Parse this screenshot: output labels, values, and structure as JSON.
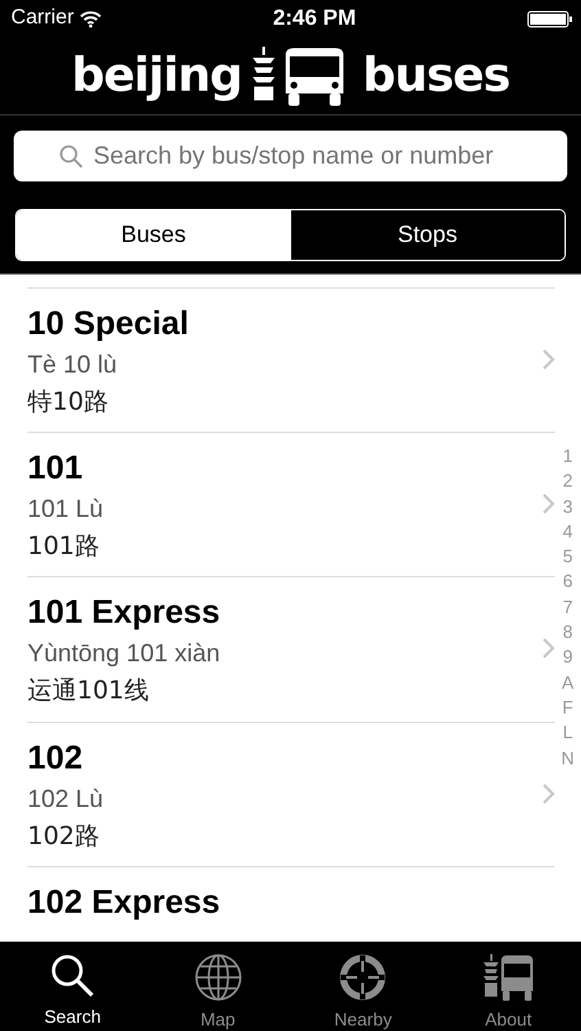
{
  "status_bar": {
    "carrier": "Carrier",
    "time": "2:46 PM"
  },
  "logo": {
    "left": "beijing",
    "right": "buses"
  },
  "search": {
    "placeholder": "Search by bus/stop name or number"
  },
  "segments": [
    {
      "label": "Buses",
      "selected": true
    },
    {
      "label": "Stops",
      "selected": false
    }
  ],
  "routes": [
    {
      "name": "10 Special",
      "pinyin": "Tè 10 lù",
      "chinese": "特10路"
    },
    {
      "name": "101",
      "pinyin": "101 Lù",
      "chinese": "101路"
    },
    {
      "name": "101 Express",
      "pinyin": "Yùntōng 101 xiàn",
      "chinese": "运通101线"
    },
    {
      "name": "102",
      "pinyin": "102 Lù",
      "chinese": "102路"
    },
    {
      "name": "102 Express"
    }
  ],
  "index": [
    "1",
    "2",
    "3",
    "4",
    "5",
    "6",
    "7",
    "8",
    "9",
    "A",
    "F",
    "L",
    "N"
  ],
  "tab_bar": [
    {
      "label": "Search",
      "kind": "search",
      "selected": true
    },
    {
      "label": "Map",
      "kind": "map",
      "selected": false
    },
    {
      "label": "Nearby",
      "kind": "nearby",
      "selected": false
    },
    {
      "label": "About",
      "kind": "about",
      "selected": false
    }
  ]
}
